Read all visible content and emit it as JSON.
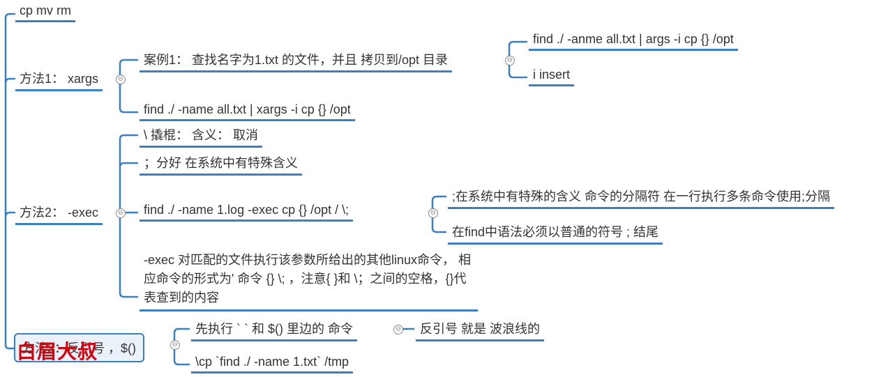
{
  "watermark": "白眉大叔",
  "nodes": {
    "n_cp": "cp  mv rm",
    "n_m1": "方法1： xargs",
    "n_m1_case1": "案例1： 查找名字为1.txt 的文件，并且 拷贝到/opt 目录",
    "n_m1_case1_cmd": "find ./ -anme   all.txt | args -i  cp {} /opt",
    "n_m1_case1_ins": "i  insert",
    "n_m1_cmd2": "find ./  -name all.txt | xargs -i cp {} /opt",
    "n_m2": "方法2： -exec",
    "n_m2_a": "\\ 撬棍： 含义： 取消",
    "n_m2_b": "；分好 在系统中有特殊含义",
    "n_m2_c": "find ./ -name 1.log -exec cp {}  /opt / \\;",
    "n_m2_c1": ";在系统中有特殊的含义 命令的分隔符 在一行执行多条命令使用;分隔",
    "n_m2_c2": "在find中语法必须以普通的符号 ; 结尾",
    "n_m2_d": "-exec       对匹配的文件执行该参数所给出的其他linux命令， 相应命令的形式为' 命令 {} \\; ，注意{ }和 \\；之间的空格，{}代表查到的内容",
    "n_m3": "方法3：反引号 ，$()",
    "n_m3_a": "先执行 ` ` 和 $() 里边的 命令",
    "n_m3_a1": "反引号 就是 波浪线的",
    "n_m3_b": "\\cp `find ./ -name 1.txt` /tmp"
  },
  "toggle_glyph": "⊖"
}
